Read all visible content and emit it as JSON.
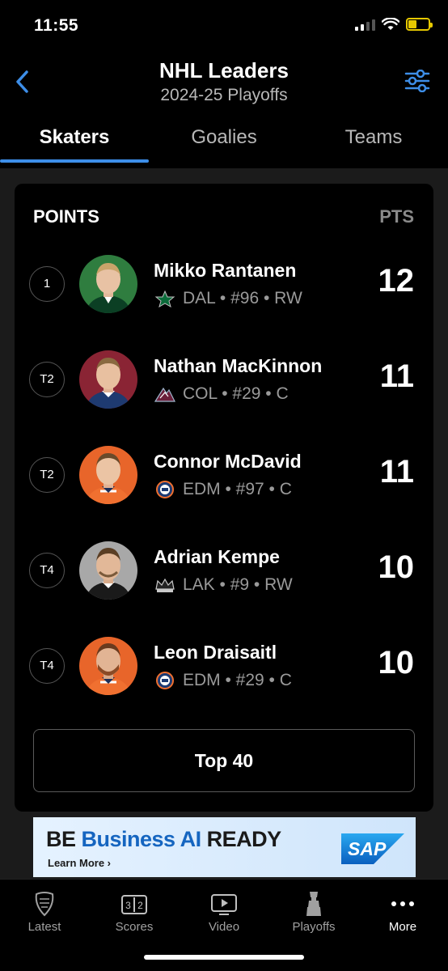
{
  "status_bar": {
    "time": "11:55"
  },
  "header": {
    "title": "NHL Leaders",
    "subtitle": "2024-25 Playoffs"
  },
  "tabs": [
    {
      "label": "Skaters",
      "active": true
    },
    {
      "label": "Goalies",
      "active": false
    },
    {
      "label": "Teams",
      "active": false
    }
  ],
  "leaders": {
    "category": "POINTS",
    "stat_label": "PTS",
    "players": [
      {
        "rank": "1",
        "name": "Mikko Rantanen",
        "team": "DAL",
        "number": "#96",
        "position": "RW",
        "info": "DAL • #96 • RW",
        "value": "12",
        "team_icon": "stars-logo-icon",
        "jersey_color": "#0b5a33"
      },
      {
        "rank": "T2",
        "name": "Nathan MacKinnon",
        "team": "COL",
        "number": "#29",
        "position": "C",
        "info": "COL • #29 • C",
        "value": "11",
        "team_icon": "avalanche-logo-icon",
        "jersey_color": "#7a1b2b"
      },
      {
        "rank": "T2",
        "name": "Connor McDavid",
        "team": "EDM",
        "number": "#97",
        "position": "C",
        "info": "EDM • #97 • C",
        "value": "11",
        "team_icon": "oilers-logo-icon",
        "jersey_color": "#e85a20"
      },
      {
        "rank": "T4",
        "name": "Adrian Kempe",
        "team": "LAK",
        "number": "#9",
        "position": "RW",
        "info": "LAK • #9 • RW",
        "value": "10",
        "team_icon": "kings-logo-icon",
        "jersey_color": "#9a9a9a"
      },
      {
        "rank": "T4",
        "name": "Leon Draisaitl",
        "team": "EDM",
        "number": "#29",
        "position": "C",
        "info": "EDM • #29 • C",
        "value": "10",
        "team_icon": "oilers-logo-icon",
        "jersey_color": "#e85a20"
      }
    ],
    "more_button": "Top 40"
  },
  "ad": {
    "text_prefix": "BE ",
    "text_highlight": "Business AI",
    "text_suffix": " READY",
    "cta": "Learn More ›",
    "brand": "SAP"
  },
  "tab_bar": [
    {
      "label": "Latest",
      "icon": "nhl-shield-icon"
    },
    {
      "label": "Scores",
      "icon": "scores-icon"
    },
    {
      "label": "Video",
      "icon": "video-play-icon"
    },
    {
      "label": "Playoffs",
      "icon": "stanley-cup-icon"
    },
    {
      "label": "More",
      "icon": "more-dots-icon",
      "active": true
    }
  ],
  "colors": {
    "accent": "#3d8ee8",
    "background": "#000000",
    "card": "#000000"
  }
}
